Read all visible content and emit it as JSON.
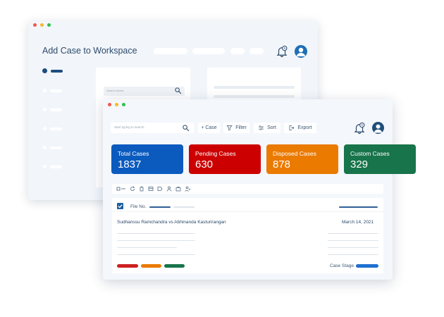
{
  "back_window": {
    "title": "Add Case to Workspace",
    "search_placeholder": "Search boxes",
    "sidebar": {
      "items": [
        {
          "icon": "sidebar-item",
          "active": true
        },
        {
          "icon": "sidebar-item"
        },
        {
          "icon": "sidebar-item"
        },
        {
          "icon": "sidebar-item"
        },
        {
          "icon": "sidebar-item"
        },
        {
          "icon": "sidebar-item"
        }
      ]
    }
  },
  "front_window": {
    "search_placeholder": "Start typing to search",
    "toolbar": {
      "add_case_label": "+ Case",
      "filter_label": "Filter",
      "sort_label": "Sort",
      "export_label": "Export"
    },
    "stats": [
      {
        "label": "Total Cases",
        "value": "1837",
        "color": "#0b5bbf"
      },
      {
        "label": "Pending Cases",
        "value": "630",
        "color": "#cc0000"
      },
      {
        "label": "Disposed Cases",
        "value": "878",
        "color": "#ea7a00"
      },
      {
        "label": "Custom Cases",
        "value": "329",
        "color": "#18744a"
      }
    ],
    "list": {
      "column_label": "File No.",
      "case_title": "Sudhanssu Ramchandra vs Abhinanda Kasturirangan",
      "case_date": "March 14, 2021",
      "stage_label": "Case Stage",
      "tag_colors": [
        "#cc1f1f",
        "#ea7a00",
        "#18744a"
      ],
      "stage_color": "#1f6fd0"
    }
  },
  "colors": {
    "accent": "#1f5f9f",
    "window_bg": "#f4f7fb"
  },
  "icons": [
    "bell-icon",
    "avatar",
    "search-icon",
    "filter-icon",
    "sort-icon",
    "export-icon",
    "checkbox-icon"
  ]
}
